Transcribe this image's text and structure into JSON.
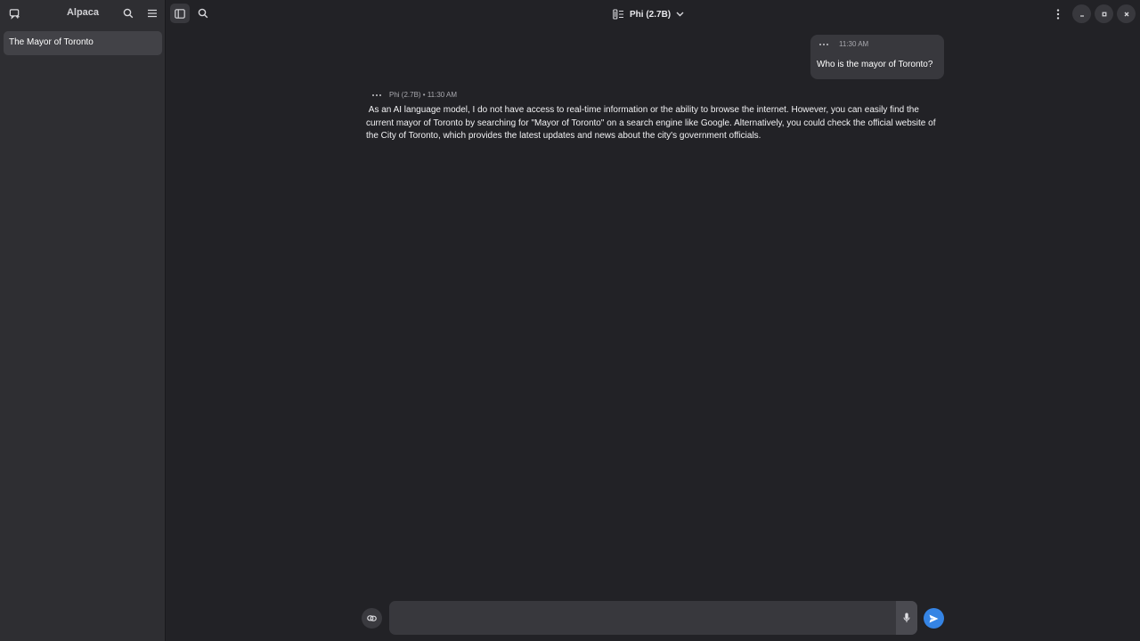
{
  "sidebar": {
    "title": "Alpaca",
    "chats": [
      {
        "label": "The Mayor of Toronto"
      }
    ]
  },
  "header": {
    "model": "Phi (2.7B)"
  },
  "messages": {
    "user": {
      "time": "11:30 AM",
      "text": "Who is the mayor of Toronto?"
    },
    "assistant": {
      "meta": "Phi (2.7B) • 11:30 AM",
      "text": " As an AI language model, I do not have access to real-time information or the ability to browse the internet. However, you can easily find the current mayor of Toronto by searching for \"Mayor of Toronto\" on a search engine like Google. Alternatively, you could check the official website of the City of Toronto, which provides the latest updates and news about the city's government officials."
    }
  },
  "composer": {
    "value": ""
  },
  "colors": {
    "accent": "#3584e4",
    "background": "#222226",
    "sidebar": "#2e2e32"
  }
}
